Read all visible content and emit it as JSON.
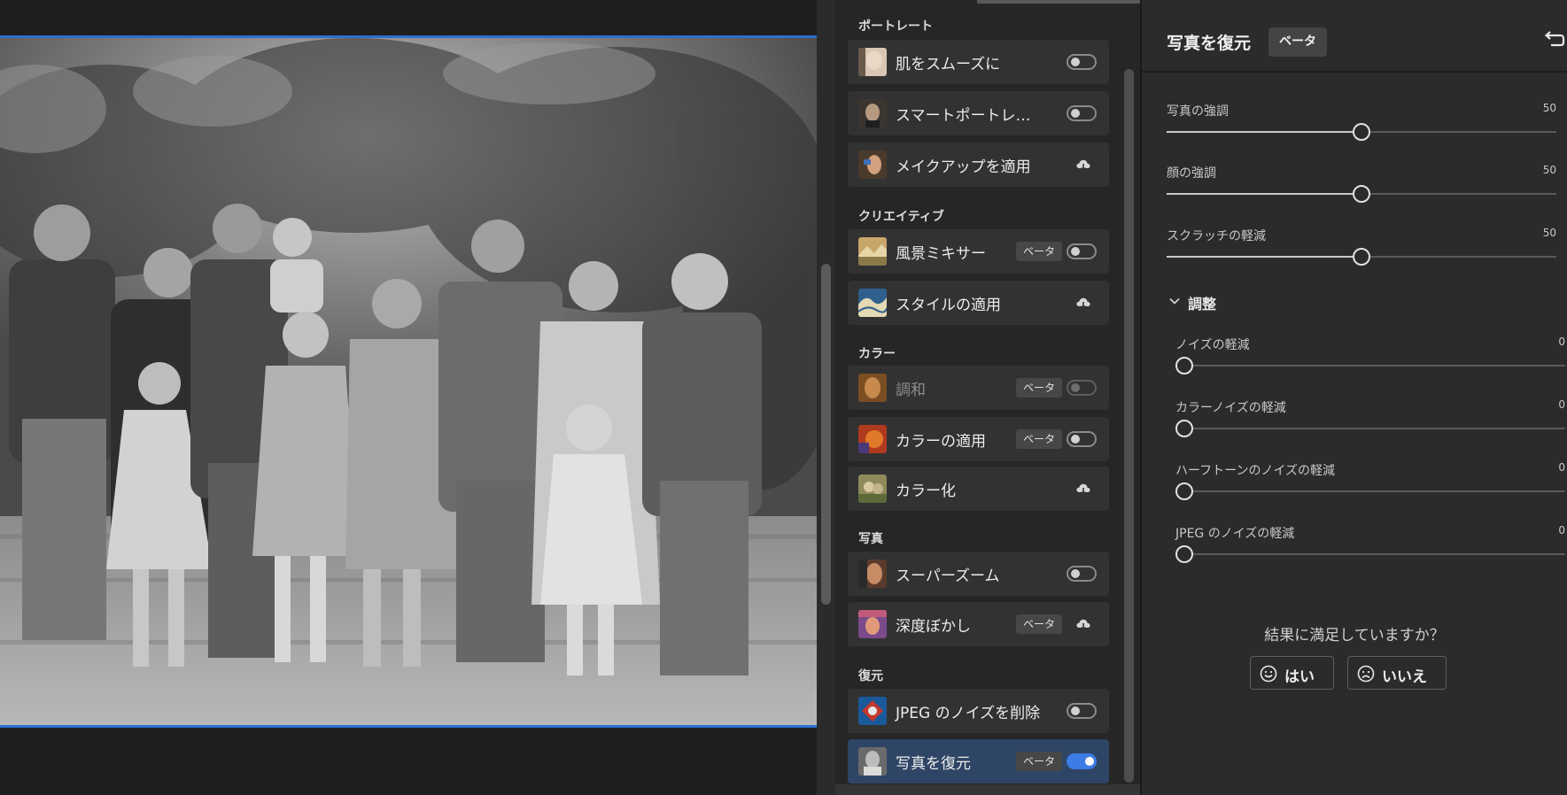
{
  "filters_panel": {
    "sections": [
      {
        "title": "ポートレート",
        "items": [
          {
            "label": "肌をスムーズに",
            "control": "toggle",
            "state": "off",
            "thumb": "portrait-face"
          },
          {
            "label": "スマートポートレ…",
            "control": "toggle",
            "state": "off",
            "thumb": "portrait-man"
          },
          {
            "label": "メイクアップを適用",
            "control": "download",
            "thumb": "portrait-makeup"
          }
        ]
      },
      {
        "title": "クリエイティブ",
        "items": [
          {
            "label": "風景ミキサー",
            "beta": "ベータ",
            "control": "toggle",
            "state": "off",
            "thumb": "landscape"
          },
          {
            "label": "スタイルの適用",
            "control": "download",
            "thumb": "style-wave"
          }
        ]
      },
      {
        "title": "カラー",
        "items": [
          {
            "label": "調和",
            "beta": "ベータ",
            "control": "toggle",
            "state": "disabled",
            "thumb": "harmony"
          },
          {
            "label": "カラーの適用",
            "beta": "ベータ",
            "control": "toggle",
            "state": "off",
            "thumb": "color-transfer"
          },
          {
            "label": "カラー化",
            "control": "download",
            "thumb": "colorize"
          }
        ]
      },
      {
        "title": "写真",
        "items": [
          {
            "label": "スーパーズーム",
            "control": "toggle",
            "state": "off",
            "thumb": "super-zoom"
          },
          {
            "label": "深度ぼかし",
            "beta": "ベータ",
            "control": "download",
            "thumb": "depth-blur"
          }
        ]
      },
      {
        "title": "復元",
        "items": [
          {
            "label": "JPEG のノイズを削除",
            "control": "toggle",
            "state": "off",
            "thumb": "jpeg-artifact"
          },
          {
            "label": "写真を復元",
            "beta": "ベータ",
            "control": "toggle",
            "state": "on",
            "selected": true,
            "thumb": "photo-restore"
          }
        ]
      }
    ]
  },
  "settings_panel": {
    "title": "写真を復元",
    "beta": "ベータ",
    "sliders": [
      {
        "label": "写真の強調",
        "value": "50",
        "fraction": 0.5
      },
      {
        "label": "顔の強調",
        "value": "50",
        "fraction": 0.5
      },
      {
        "label": "スクラッチの軽減",
        "value": "50",
        "fraction": 0.5
      }
    ],
    "adjust": {
      "label": "調整",
      "sliders": [
        {
          "label": "ノイズの軽減",
          "value": "0",
          "fraction": 0
        },
        {
          "label": "カラーノイズの軽減",
          "value": "0",
          "fraction": 0
        },
        {
          "label": "ハーフトーンのノイズの軽減",
          "value": "0",
          "fraction": 0
        },
        {
          "label": "JPEG のノイズの軽減",
          "value": "0",
          "fraction": 0
        }
      ]
    },
    "feedback": {
      "question": "結果に満足していますか？",
      "yes": "はい",
      "no": "いいえ"
    }
  },
  "colors": {
    "accent": "#3d7be6",
    "selected_row": "#2f4566",
    "canvas_border": "#2d6fd1"
  }
}
